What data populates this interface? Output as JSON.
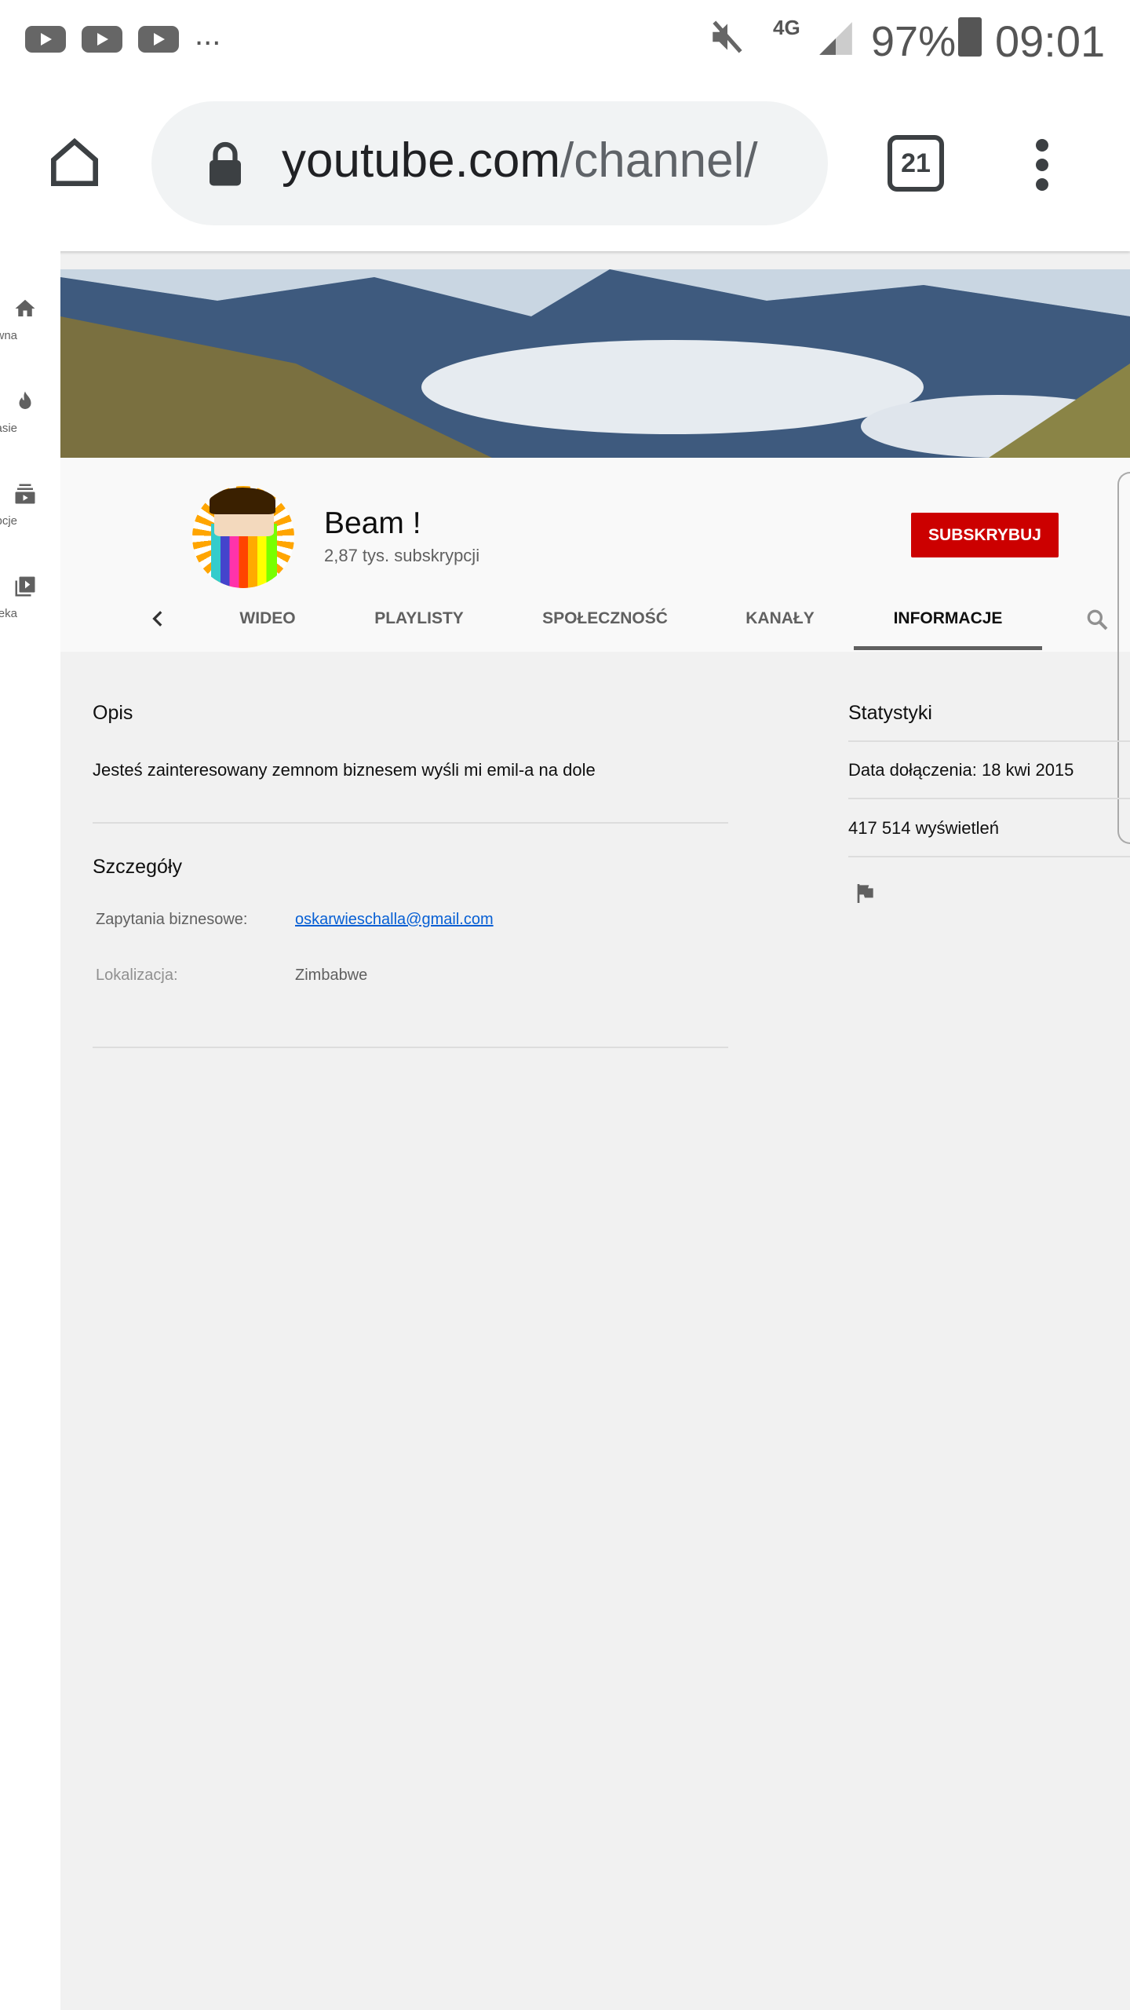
{
  "status_bar": {
    "notifications": [
      "youtube-icon",
      "youtube-icon",
      "youtube-icon"
    ],
    "more": "...",
    "network": "4G",
    "battery": "97%",
    "time": "09:01"
  },
  "browser": {
    "url_domain": "youtube.com",
    "url_path": "/channel/",
    "tab_count": "21"
  },
  "sidebar": {
    "items": [
      {
        "label": "Główna",
        "icon": "home-icon"
      },
      {
        "label": "Na czasie",
        "icon": "flame-icon"
      },
      {
        "label": "Subskrypcje",
        "icon": "subscriptions-icon"
      },
      {
        "label": "Biblioteka",
        "icon": "library-icon"
      }
    ]
  },
  "channel": {
    "name": "Beam !",
    "subscribers": "2,87 tys. subskrypcji",
    "subscribe_label": "SUBSKRYBUJ",
    "accent": "#cc0000"
  },
  "tabs": [
    {
      "label": "WIDEO"
    },
    {
      "label": "PLAYLISTY"
    },
    {
      "label": "SPOŁECZNOŚĆ"
    },
    {
      "label": "KANAŁY"
    },
    {
      "label": "INFORMACJE",
      "active": true
    }
  ],
  "about": {
    "description_title": "Opis",
    "description": "Jesteś zainteresowany zemnom biznesem wyśli mi emil-a na dole",
    "details_title": "Szczegóły",
    "business_label": "Zapytania biznesowe:",
    "business_email": "oskarwieschalla@gmail.com",
    "location_label": "Lokalizacja:",
    "location": "Zimbabwe"
  },
  "stats": {
    "title": "Statystyki",
    "joined": "Data dołączenia: 18 kwi 2015",
    "views": "417 514 wyświetleń"
  }
}
